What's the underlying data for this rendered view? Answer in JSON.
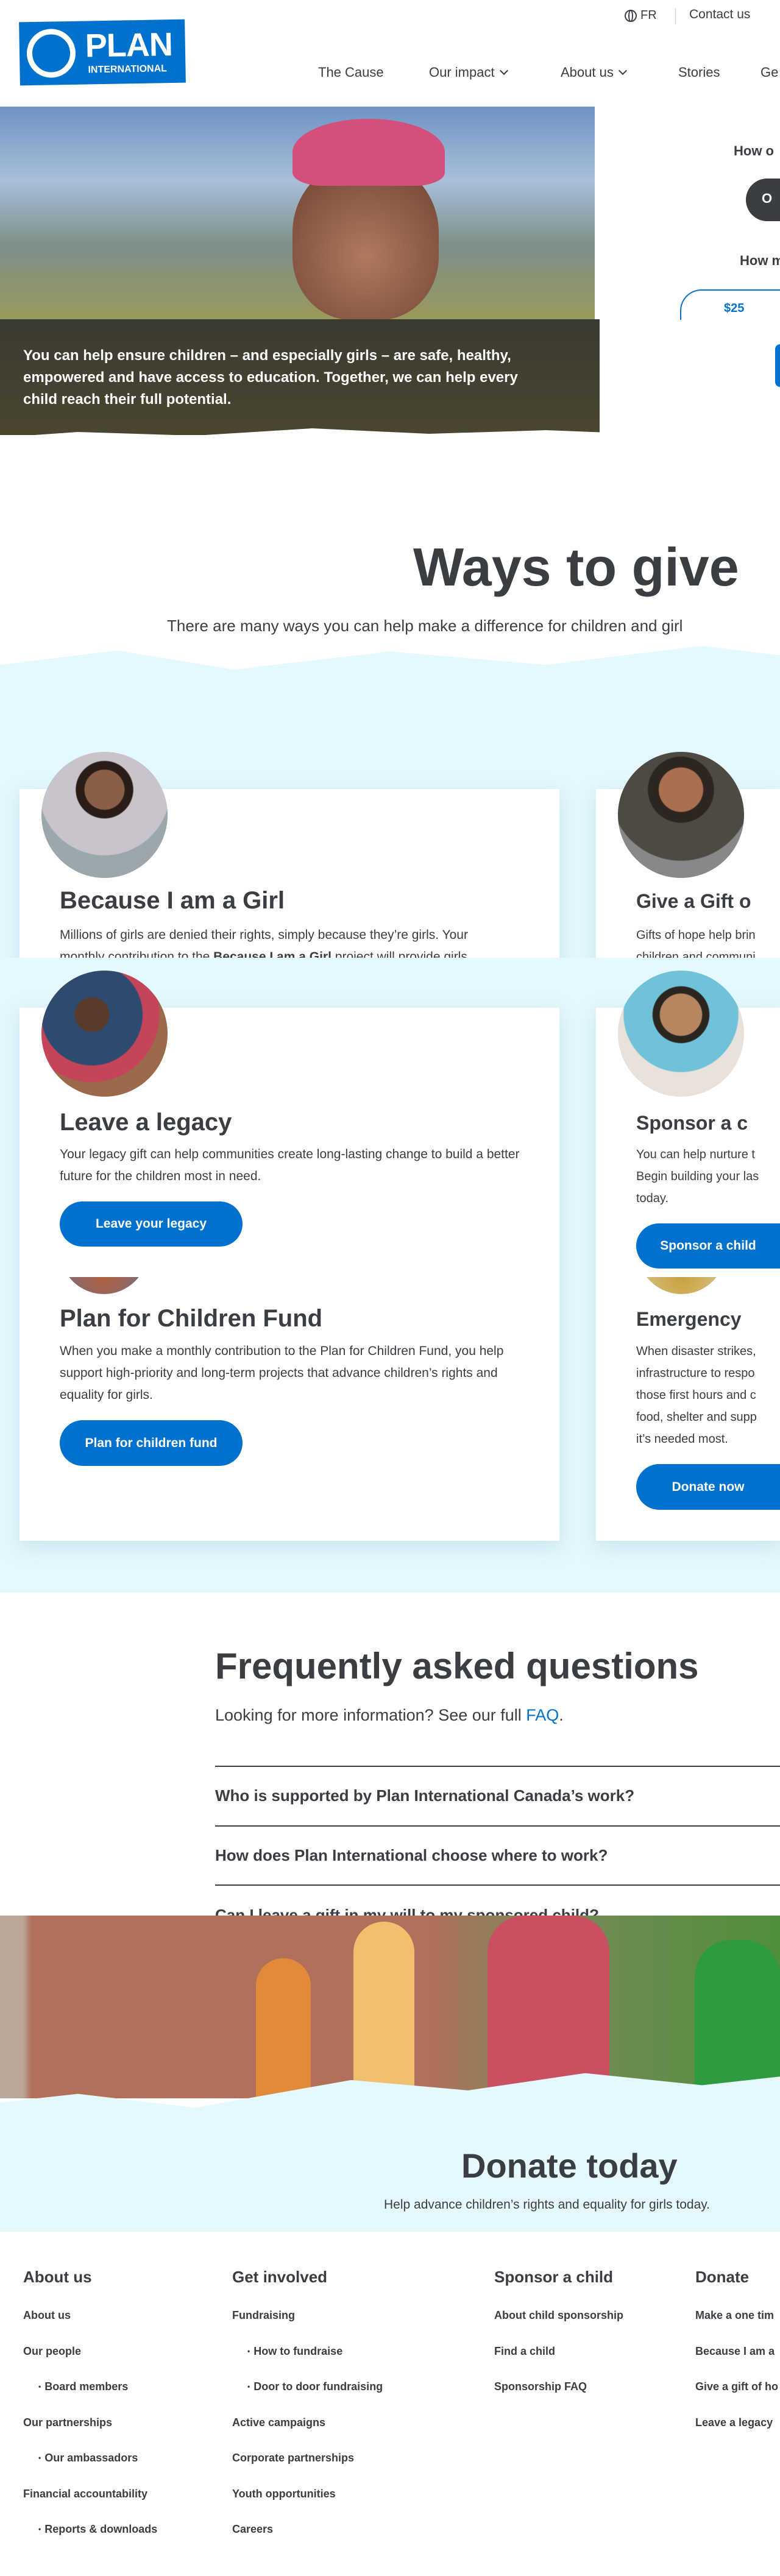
{
  "header": {
    "logo_text": "PLAN",
    "logo_subtext": "INTERNATIONAL",
    "language": "FR",
    "contact": "Contact us",
    "nav": [
      "The Cause",
      "Our impact",
      "About us",
      "Stories",
      "Ge"
    ]
  },
  "hero": {
    "text": "You can help ensure children – and especially girls – are safe, healthy, empowered and have access to education. Together, we can help every child reach their full potential.",
    "form": {
      "freq_label": "How o",
      "freq_option": "O",
      "amount_label": "How m",
      "amount_option": "$25"
    }
  },
  "ways": {
    "title": "Ways to give",
    "subtitle": "There are many ways you can help make a difference for children and girl"
  },
  "cards": [
    {
      "title": "Because I am a Girl",
      "body1": "Millions of girls are denied their rights, simply because they’re girls. Your",
      "body2a": "monthly contribution to the ",
      "body2b": "Because I am a Girl",
      "body2c": " project will provide girls"
    },
    {
      "title": "Give a Gift o",
      "body1": "Gifts of hope help brin",
      "body2": "children and communi"
    },
    {
      "title": "Leave a legacy",
      "body": "Your legacy gift can help communities create long-lasting change to build a better future for the children most in need.",
      "button": "Leave your legacy"
    },
    {
      "title": "Sponsor a c",
      "body1": "You can help nurture t",
      "body2": "Begin building your las",
      "body3": "today.",
      "button": "Sponsor a child"
    },
    {
      "title": "Plan for Children Fund",
      "body": "When you make a monthly contribution to the Plan for Children Fund, you help support high-priority and long-term projects that advance children’s rights and equality for girls.",
      "button": "Plan for children fund"
    },
    {
      "title": "Emergency",
      "body1": "When disaster strikes,",
      "body2": "infrastructure to respo",
      "body3": "those first hours and c",
      "body4": "food, shelter and supp",
      "body5": "it’s needed most.",
      "button": "Donate now"
    }
  ],
  "faq": {
    "title": "Frequently asked questions",
    "intro": "Looking for more information? See our full ",
    "link": "FAQ",
    "period": ".",
    "questions": [
      "Who is supported by Plan International Canada’s work?",
      "How does Plan International choose where to work?",
      "Can I leave a gift in my will to my sponsored child?"
    ]
  },
  "donate": {
    "title": "Donate today",
    "subtitle": "Help advance children’s rights and equality for girls today."
  },
  "footer": {
    "columns": [
      {
        "heading": "About us",
        "items": [
          "About us",
          "Our people",
          "Board members",
          "Our partnerships",
          "Our ambassadors",
          "Financial accountability",
          "Reports & downloads"
        ]
      },
      {
        "heading": "Get involved",
        "items": [
          "Fundraising",
          "How to fundraise",
          "Door to door fundraising",
          "Active campaigns",
          "Corporate partnerships",
          "Youth opportunities",
          "Careers"
        ]
      },
      {
        "heading": "Sponsor a child",
        "items": [
          "About child sponsorship",
          "Find a child",
          "Sponsorship FAQ"
        ]
      },
      {
        "heading": "Donate",
        "items": [
          "Make a one tim",
          "Because I am a",
          "Give a gift of ho",
          "Leave a legacy"
        ]
      }
    ]
  },
  "colors": {
    "brand": "#0072ce",
    "text": "#3a3d42",
    "band": "#e4f8fd"
  }
}
